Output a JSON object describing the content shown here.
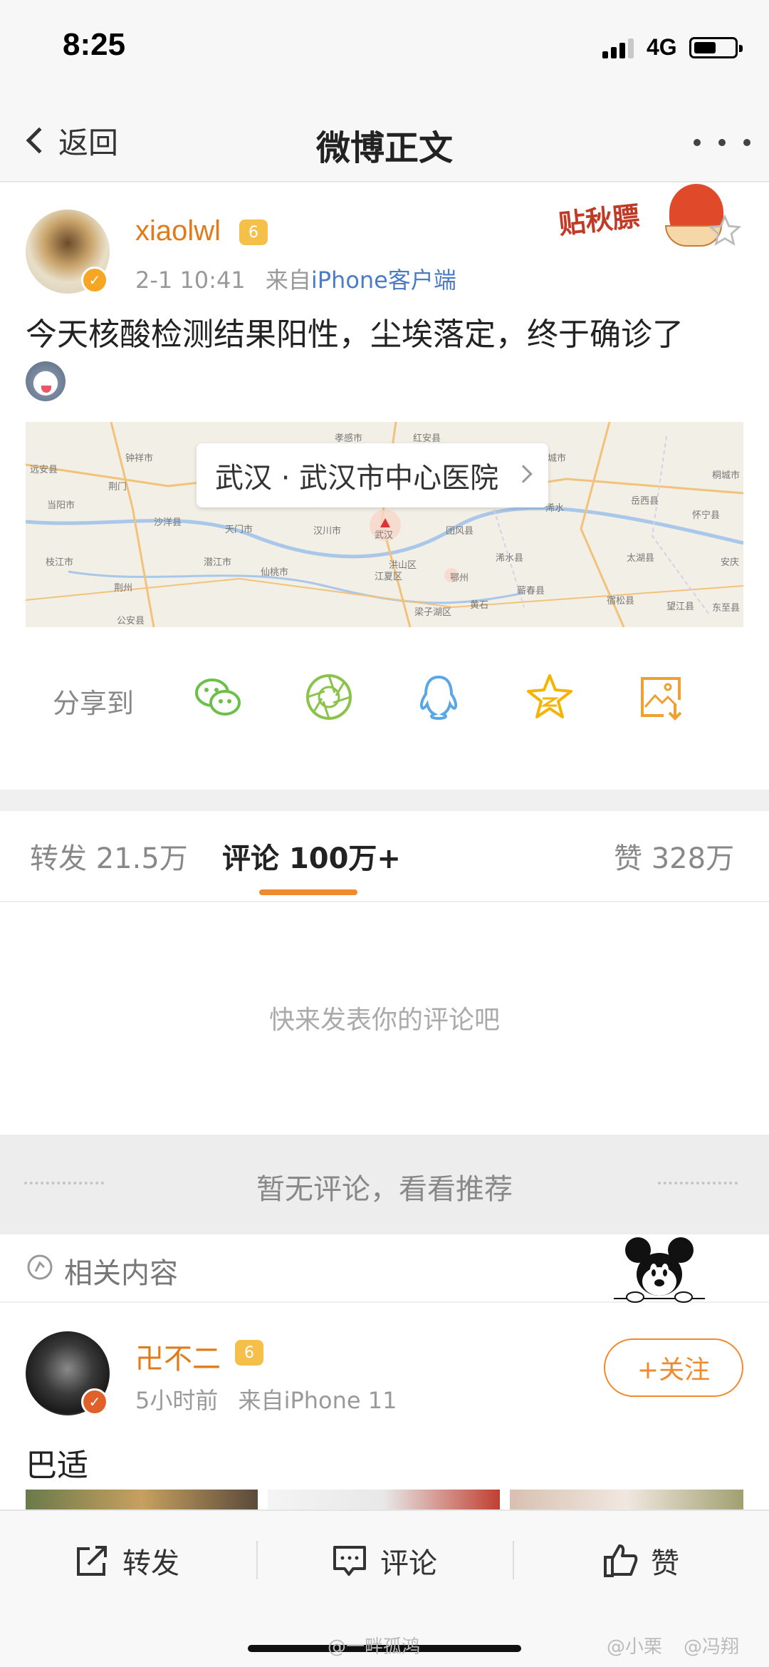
{
  "status_bar": {
    "time": "8:25",
    "network": "4G"
  },
  "nav": {
    "back_label": "返回",
    "title": "微博正文"
  },
  "post": {
    "username": "xiaolwl",
    "crown_level": "6",
    "date": "2-1 10:41",
    "source_prefix": "来自",
    "source": "iPhone客户端",
    "sticker_text": "贴秋膘",
    "text": "今天核酸检测结果阳性，尘埃落定，终于确诊了",
    "location": "武汉 · 武汉市中心医院"
  },
  "map": {
    "towns": [
      "远安县",
      "当阳市",
      "枝江市",
      "荆门",
      "沙洋县",
      "荆州",
      "公安县",
      "钟祥市",
      "天门市",
      "潜江市",
      "仙桃市",
      "汉川市",
      "孝感市",
      "红安县",
      "武汉",
      "洪山区",
      "江夏区",
      "团风县",
      "鄂州",
      "黄石",
      "浠水县",
      "梁子湖区",
      "蕲春县",
      "麻城市",
      "浠水",
      "岳西县",
      "太湖县",
      "怀宁县",
      "安庆",
      "宿松县",
      "望江县",
      "东至县",
      "桐城市"
    ]
  },
  "share": {
    "label": "分享到",
    "icons": [
      "wechat-icon",
      "moments-icon",
      "qq-icon",
      "qzone-icon",
      "save-image-icon"
    ],
    "colors": {
      "wechat": "#6cc04a",
      "moments": "#8bc34a",
      "qq": "#5aa7e6",
      "qzone": "#f5b400",
      "save": "#f0a030"
    }
  },
  "tabs": {
    "repost_label": "转发",
    "repost_count": "21.5万",
    "comment_label": "评论",
    "comment_count": "100万+",
    "like_label": "赞",
    "like_count": "328万"
  },
  "empty_comments": "快来发表你的评论吧",
  "recommend_text": "暂无评论，看看推荐",
  "related": {
    "label": "相关内容"
  },
  "rec_post": {
    "username": "卍不二",
    "crown_level": "6",
    "time": "5小时前",
    "source_prefix": "来自",
    "source": "iPhone 11",
    "follow_label": "+关注",
    "text": "巴适"
  },
  "actions": {
    "repost": "转发",
    "comment": "评论",
    "like": "赞"
  },
  "watermarks": [
    "@一畔孤鸿",
    "@小栗",
    "@冯翔"
  ],
  "colors": {
    "accent": "#f08a2e",
    "username": "#e07b1a",
    "link": "#4a7cc7"
  }
}
